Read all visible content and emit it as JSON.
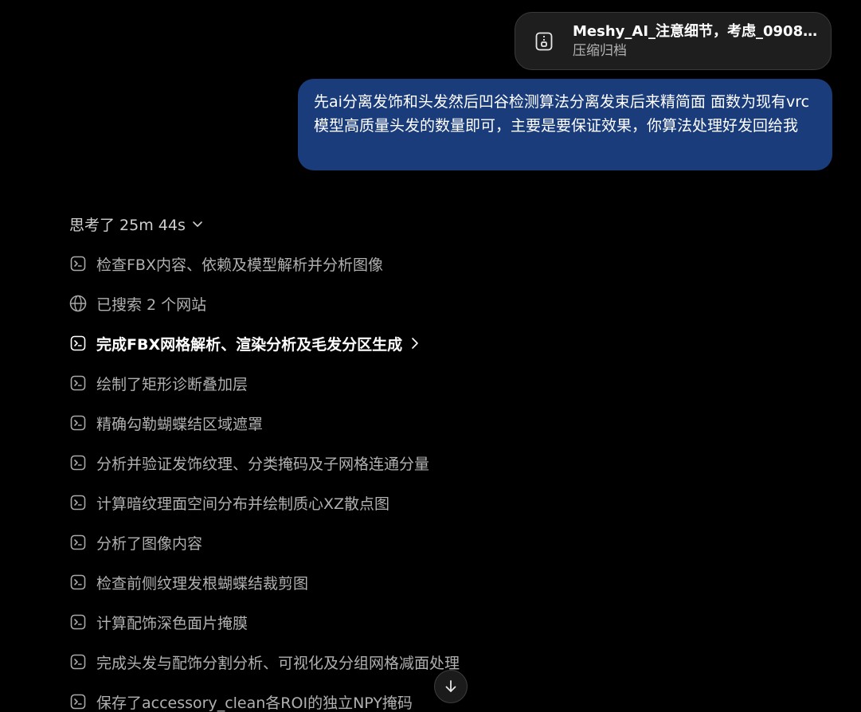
{
  "attachment": {
    "name": "Meshy_AI_注意细节，考虑_090803...",
    "type": "压缩归档",
    "icon": "archive-icon"
  },
  "user_message": {
    "text": "先ai分离发饰和头发然后凹谷检测算法分离发束后来精简面  面数为现有vrc模型高质量头发的数量即可，主要是要保证效果，你算法处理好发回给我"
  },
  "thinking": {
    "label": "思考了 25m 44s",
    "icon": "chevron-down-icon"
  },
  "steps": [
    {
      "label": "检查FBX内容、依赖及模型解析并分析图像",
      "icon": "terminal-icon"
    },
    {
      "label": "已搜索 2 个网站",
      "icon": "globe-icon"
    },
    {
      "label": "完成FBX网格解析、渲染分析及毛发分区生成",
      "icon": "terminal-icon",
      "expandable": true
    },
    {
      "label": "绘制了矩形诊断叠加层",
      "icon": "terminal-icon"
    },
    {
      "label": "精确勾勒蝴蝶结区域遮罩",
      "icon": "terminal-icon"
    },
    {
      "label": "分析并验证发饰纹理、分类掩码及子网格连通分量",
      "icon": "terminal-icon"
    },
    {
      "label": "计算暗纹理面空间分布并绘制质心XZ散点图",
      "icon": "terminal-icon"
    },
    {
      "label": "分析了图像内容",
      "icon": "terminal-icon"
    },
    {
      "label": "检查前侧纹理发根蝴蝶结裁剪图",
      "icon": "terminal-icon"
    },
    {
      "label": "计算配饰深色面片掩膜",
      "icon": "terminal-icon"
    },
    {
      "label": "完成头发与配饰分割分析、可视化及分组网格减面处理",
      "icon": "terminal-icon"
    },
    {
      "label": "保存了accessory_clean各ROI的独立NPY掩码",
      "icon": "terminal-icon"
    }
  ],
  "scroll_button": {
    "icon": "arrow-down-icon"
  },
  "colors": {
    "background": "#000000",
    "bubble": "#1a3c7a",
    "card": "#1e1e1e",
    "muted_text": "#b0b0b0",
    "active_text": "#ffffff"
  }
}
